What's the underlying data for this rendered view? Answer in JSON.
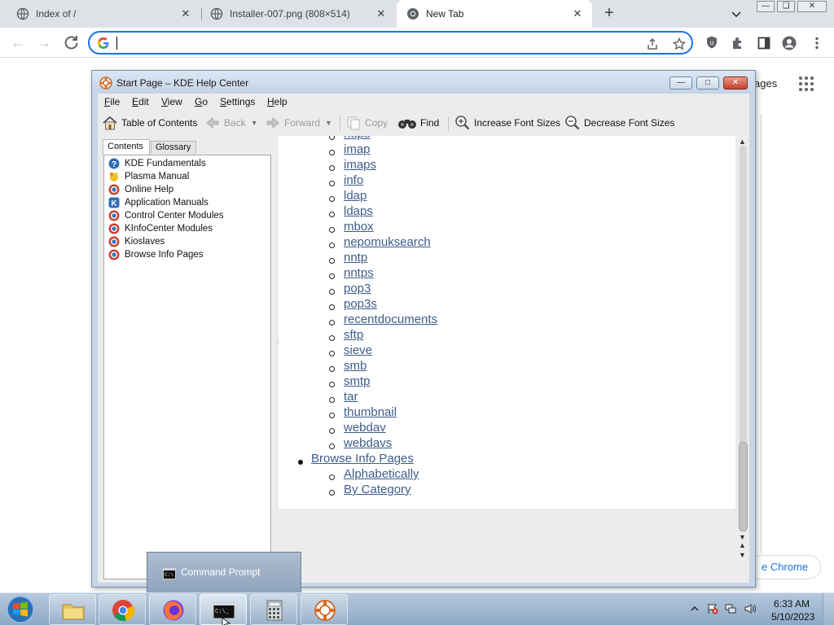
{
  "chrome": {
    "tabs": [
      {
        "title": "Index of /",
        "active": false
      },
      {
        "title": "Installer-007.png (808×514)",
        "active": false
      },
      {
        "title": "New Tab",
        "active": true
      }
    ],
    "new_tab_label": "+",
    "close_glyph": "✕",
    "omnibox": {
      "value": "",
      "placeholder": ""
    },
    "page_fragments": {
      "top_right_text": "ages",
      "bottom_pill": "e Chrome"
    }
  },
  "khelp": {
    "title": "Start Page – KDE Help Center",
    "menu": [
      {
        "label": "File",
        "mnemonic": "F",
        "rest": "ile"
      },
      {
        "label": "Edit",
        "mnemonic": "E",
        "rest": "dit"
      },
      {
        "label": "View",
        "mnemonic": "V",
        "rest": "iew"
      },
      {
        "label": "Go",
        "mnemonic": "G",
        "rest": "o"
      },
      {
        "label": "Settings",
        "mnemonic": "S",
        "rest": "ettings"
      },
      {
        "label": "Help",
        "mnemonic": "H",
        "rest": "elp"
      }
    ],
    "toolbar": {
      "toc": "Table of Contents",
      "back": "Back",
      "forward": "Forward",
      "copy": "Copy",
      "find": "Find",
      "increase_font": "Increase Font Sizes",
      "decrease_font": "Decrease Font Sizes"
    },
    "nav_tabs": {
      "contents": "Contents",
      "glossary": "Glossary"
    },
    "tree": [
      {
        "label": "KDE Fundamentals",
        "icon": "help-icon"
      },
      {
        "label": "Plasma Manual",
        "icon": "plasma-icon"
      },
      {
        "label": "Online Help",
        "icon": "book-icon"
      },
      {
        "label": "Application Manuals",
        "icon": "kde-icon"
      },
      {
        "label": "Control Center Modules",
        "icon": "book-icon"
      },
      {
        "label": "KInfoCenter Modules",
        "icon": "book-icon"
      },
      {
        "label": "Kioslaves",
        "icon": "book-icon"
      },
      {
        "label": "Browse Info Pages",
        "icon": "book-icon"
      }
    ],
    "content": {
      "kioslaves_partial": [
        "https",
        "imap",
        "imaps",
        "info",
        "ldap",
        "ldaps",
        "mbox",
        "nepomuksearch",
        "nntp",
        "nntps",
        "pop3",
        "pop3s",
        "recentdocuments",
        "sftp",
        "sieve",
        "smb",
        "smtp",
        "tar",
        "thumbnail",
        "webdav",
        "webdavs"
      ],
      "browse_info_pages": "Browse Info Pages",
      "info_sub": [
        "Alphabetically",
        "By Category"
      ]
    }
  },
  "popup": {
    "label": "Command Prompt"
  },
  "taskbar": {
    "apps": [
      "file-explorer",
      "chrome",
      "firefox",
      "command-prompt",
      "calculator",
      "kde-help"
    ],
    "clock": {
      "time": "6:33 AM",
      "date": "5/10/2023"
    }
  }
}
